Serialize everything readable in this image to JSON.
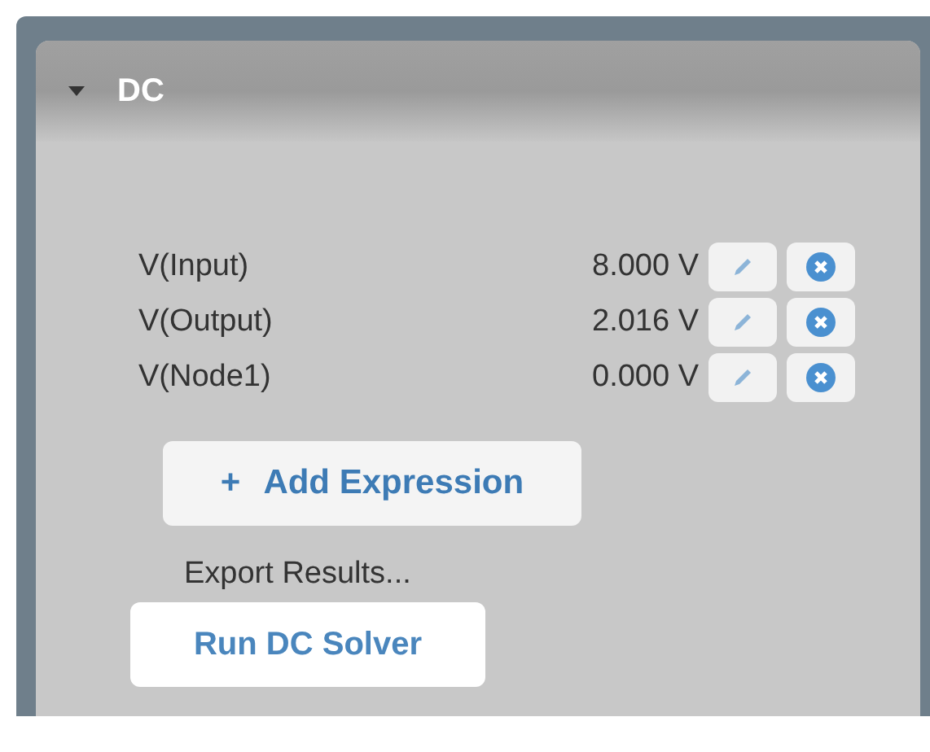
{
  "panel": {
    "title": "DC",
    "expanded": true
  },
  "measurements": [
    {
      "name": "V(Input)",
      "value": "8.000 V"
    },
    {
      "name": "V(Output)",
      "value": "2.016 V"
    },
    {
      "name": "V(Node1)",
      "value": "0.000 V"
    }
  ],
  "add_button": {
    "icon": "+",
    "label": "Add Expression"
  },
  "export_link": "Export Results...",
  "run_button": "Run DC Solver"
}
